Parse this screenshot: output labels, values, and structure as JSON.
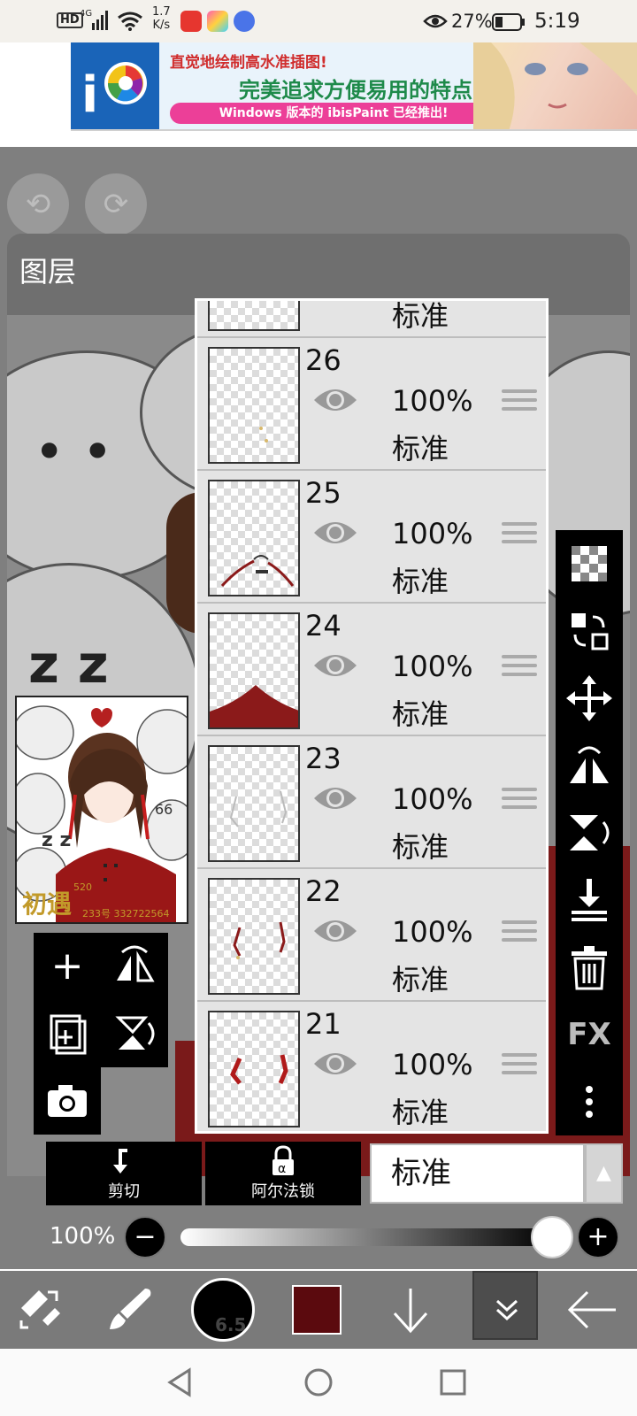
{
  "status_bar": {
    "network_badge": "HD",
    "signal": "4G",
    "speed_value": "1.7",
    "speed_unit": "K/s",
    "battery_percent": "27%",
    "time": "5:19"
  },
  "ad_banner": {
    "line1": "直觉地绘制高水准插图!",
    "line2": "完美追求方便易用的特点!",
    "line3": "Windows 版本的 ibisPaint 已经推出!"
  },
  "layer_panel": {
    "title": "图层",
    "top_partial_mode": "标准",
    "layers": [
      {
        "number": "26",
        "opacity": "100%",
        "mode": "标准"
      },
      {
        "number": "25",
        "opacity": "100%",
        "mode": "标准"
      },
      {
        "number": "24",
        "opacity": "100%",
        "mode": "标准"
      },
      {
        "number": "23",
        "opacity": "100%",
        "mode": "标准"
      },
      {
        "number": "22",
        "opacity": "100%",
        "mode": "标准"
      },
      {
        "number": "21",
        "opacity": "100%",
        "mode": "标准"
      }
    ]
  },
  "preview": {
    "text_name": "初遇",
    "text_num": "520",
    "text_small": "233号 332722564"
  },
  "right_tools": {
    "fx_label": "FX"
  },
  "blend_bar": {
    "clip_label": "剪切",
    "alpha_lock_label": "阿尔法锁",
    "blend_mode": "标准"
  },
  "opacity_slider": {
    "label": "100%",
    "value": 100
  },
  "toolbar": {
    "brush_size": "6.5",
    "color": "#5b0a0e"
  },
  "colors": {
    "accent_red": "#8b1a1a",
    "panel_bg": "#e4e4e4"
  }
}
